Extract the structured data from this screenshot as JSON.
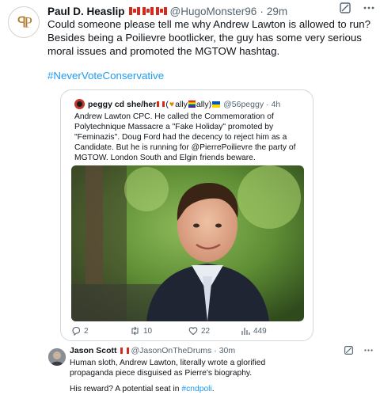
{
  "tweet": {
    "author_name": "Paul D. Heaslip",
    "author_flags": [
      "canada-flag",
      "canada-flag",
      "canada-flag"
    ],
    "handle": "@HugoMonster96",
    "separator": "·",
    "time": "29m",
    "avatar_logo": "PP",
    "text": "Could someone please tell me why Andrew Lawton is allowed to run? Besides being a Poilievre bootlicker, the guy has some very serious moral issues and promoted the MGTOW hashtag.",
    "hashtag": "#NeverVoteConservative",
    "icons": {
      "grok": "grok-icon",
      "more": "more-icon"
    }
  },
  "quote": {
    "name": "peggy cd she/her",
    "name_suffix_open": " (",
    "ally_1": "ally",
    "ally_2": "ally)",
    "handle": "@56peggy",
    "separator": "·",
    "time": "4h",
    "text": "Andrew Lawton CPC.  He called the Commemoration of Polytechnique Massacre a \"Fake Holiday\" promoted by \"Feminazis\".  Doug Ford had the decency to reject him as a Candidate.  But he is running for @PierrePoilievre the party of MGTOW.  London South and Elgin friends beware.",
    "actions": {
      "replies": "2",
      "reposts": "10",
      "likes": "22",
      "views": "449"
    }
  },
  "reply": {
    "name": "Jason Scott",
    "handle": "@JasonOnTheDrums",
    "separator": "·",
    "time": "30m",
    "text": "Human sloth, Andrew Lawton, literally wrote a glorified propaganda piece disguised as Pierre's biography.",
    "text2_prefix": "His reward?  A potential seat in ",
    "text2_tag": "#cndpoli",
    "text2_suffix": "."
  },
  "colors": {
    "link": "#1d9bf0",
    "text": "#0f1419",
    "muted": "#536471",
    "border": "#cfd9de",
    "canada_red": "#d52b1e"
  }
}
